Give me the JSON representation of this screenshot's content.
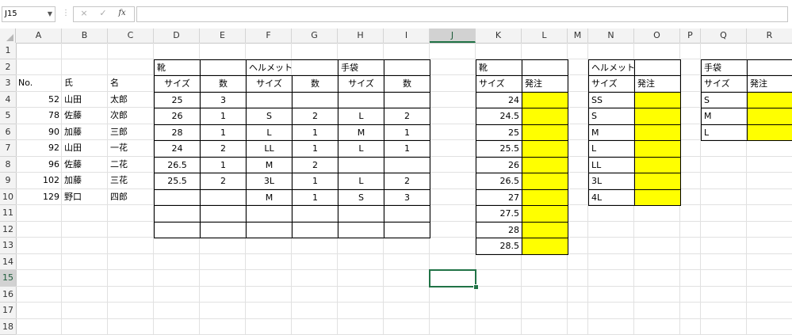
{
  "formula_bar": {
    "name_box": "J15",
    "cancel_icon": "×",
    "enter_icon": "✓",
    "fx_label": "fx",
    "formula": ""
  },
  "columns": [
    "A",
    "B",
    "C",
    "D",
    "E",
    "F",
    "G",
    "H",
    "I",
    "J",
    "K",
    "L",
    "M",
    "N",
    "O",
    "P",
    "Q",
    "R"
  ],
  "rows": [
    "1",
    "2",
    "3",
    "4",
    "5",
    "6",
    "7",
    "8",
    "9",
    "10",
    "11",
    "12",
    "13",
    "14",
    "15",
    "16",
    "17",
    "18"
  ],
  "selected": {
    "col": "J",
    "row": "15"
  },
  "main_table": {
    "headers_row2": {
      "shoes": "靴",
      "helmet": "ヘルメット",
      "gloves": "手袋"
    },
    "headers_row3": {
      "no": "No.",
      "last": "氏",
      "first": "名",
      "shoe_size": "サイズ",
      "shoe_qty": "数",
      "helmet_size": "サイズ",
      "helmet_qty": "数",
      "glove_size": "サイズ",
      "glove_qty": "数"
    },
    "records": [
      {
        "no": "52",
        "last": "山田",
        "first": "太郎",
        "shoe_size": "25",
        "shoe_qty": "3",
        "helmet_size": "",
        "helmet_qty": "",
        "glove_size": "",
        "glove_qty": ""
      },
      {
        "no": "78",
        "last": "佐藤",
        "first": "次郎",
        "shoe_size": "26",
        "shoe_qty": "1",
        "helmet_size": "S",
        "helmet_qty": "2",
        "glove_size": "L",
        "glove_qty": "2"
      },
      {
        "no": "90",
        "last": "加藤",
        "first": "三郎",
        "shoe_size": "28",
        "shoe_qty": "1",
        "helmet_size": "L",
        "helmet_qty": "1",
        "glove_size": "M",
        "glove_qty": "1"
      },
      {
        "no": "92",
        "last": "山田",
        "first": "一花",
        "shoe_size": "24",
        "shoe_qty": "2",
        "helmet_size": "LL",
        "helmet_qty": "1",
        "glove_size": "L",
        "glove_qty": "1"
      },
      {
        "no": "96",
        "last": "佐藤",
        "first": "二花",
        "shoe_size": "26.5",
        "shoe_qty": "1",
        "helmet_size": "M",
        "helmet_qty": "2",
        "glove_size": "",
        "glove_qty": ""
      },
      {
        "no": "102",
        "last": "加藤",
        "first": "三花",
        "shoe_size": "25.5",
        "shoe_qty": "2",
        "helmet_size": "3L",
        "helmet_qty": "1",
        "glove_size": "L",
        "glove_qty": "2"
      },
      {
        "no": "129",
        "last": "野口",
        "first": "四郎",
        "shoe_size": "",
        "shoe_qty": "",
        "helmet_size": "M",
        "helmet_qty": "1",
        "glove_size": "S",
        "glove_qty": "3"
      }
    ]
  },
  "shoe_order": {
    "title": "靴",
    "size_label": "サイズ",
    "order_label": "発注",
    "sizes": [
      "24",
      "24.5",
      "25",
      "25.5",
      "26",
      "26.5",
      "27",
      "27.5",
      "28",
      "28.5"
    ]
  },
  "helmet_order": {
    "title": "ヘルメット",
    "size_label": "サイズ",
    "order_label": "発注",
    "sizes": [
      "SS",
      "S",
      "M",
      "L",
      "LL",
      "3L",
      "4L"
    ]
  },
  "glove_order": {
    "title": "手袋",
    "size_label": "サイズ",
    "order_label": "発注",
    "sizes": [
      "S",
      "M",
      "L"
    ]
  },
  "colors": {
    "order_fill": "#ffff00",
    "selection": "#217346"
  }
}
